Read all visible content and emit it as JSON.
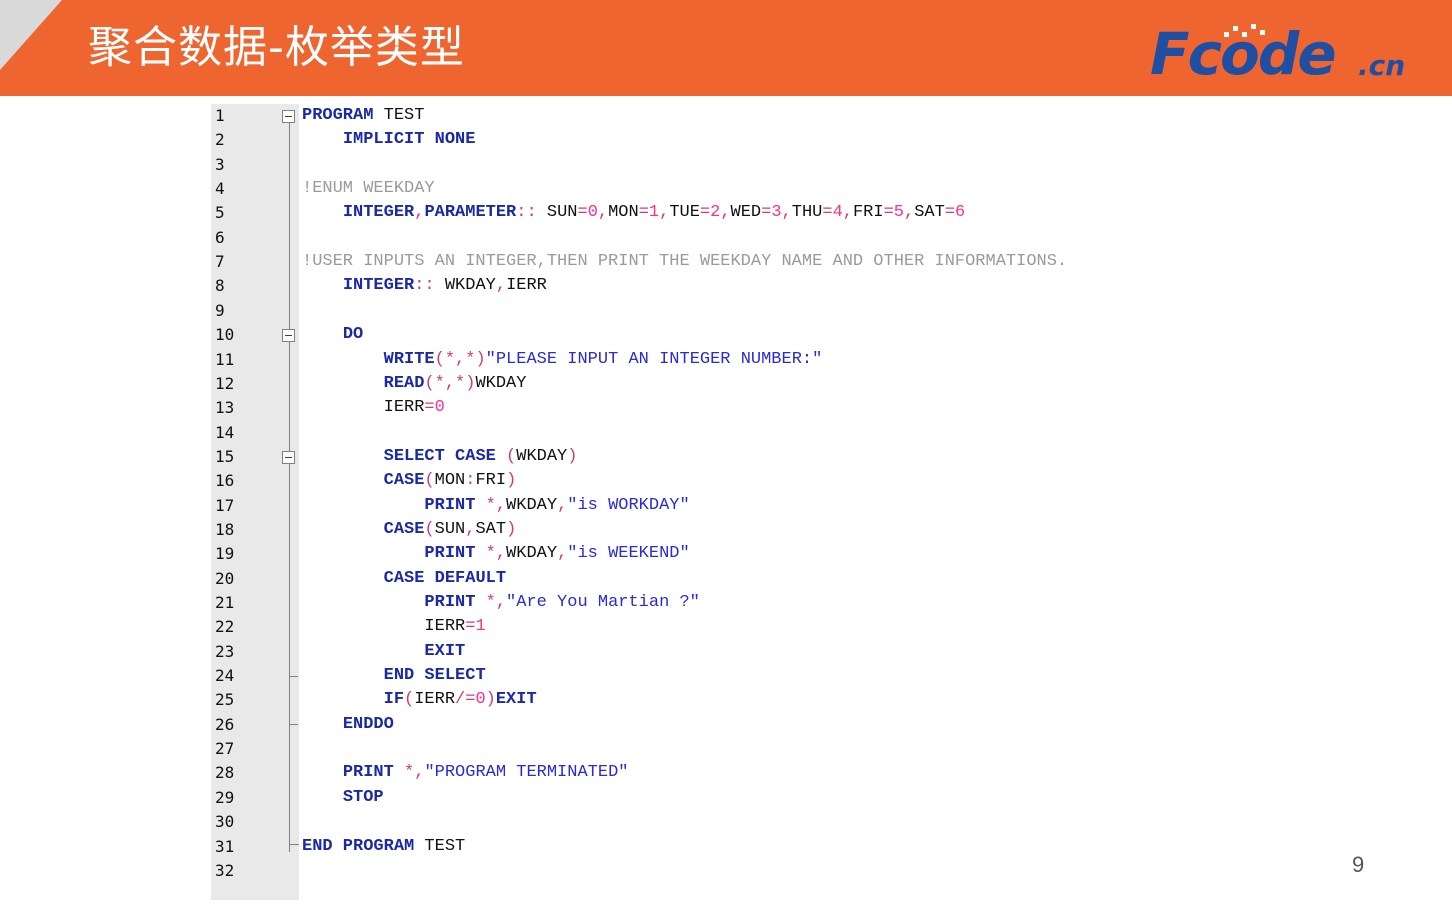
{
  "slide": {
    "title": "聚合数据-枚举类型",
    "page_number": "9",
    "logo": {
      "main": "Fcode",
      "suffix": ".cn"
    },
    "colors": {
      "header_bg": "#ef6530",
      "keyword": "#1a2aa6",
      "number": "#ff2f8f",
      "string": "#2a2ad8",
      "comment": "#9a9a9a"
    }
  },
  "code": {
    "lines": [
      {
        "n": "1",
        "tokens": [
          [
            "kw",
            "PROGRAM"
          ],
          [
            "id",
            " TEST"
          ]
        ]
      },
      {
        "n": "2",
        "tokens": [
          [
            "id",
            "    "
          ],
          [
            "kw",
            "IMPLICIT NONE"
          ]
        ]
      },
      {
        "n": "3",
        "tokens": []
      },
      {
        "n": "4",
        "tokens": [
          [
            "cm",
            "!ENUM WEEKDAY"
          ]
        ]
      },
      {
        "n": "5",
        "tokens": [
          [
            "id",
            "    "
          ],
          [
            "kw",
            "INTEGER"
          ],
          [
            "op",
            ","
          ],
          [
            "kw",
            "PARAMETER"
          ],
          [
            "op",
            "::"
          ],
          [
            "id",
            " SUN"
          ],
          [
            "op",
            "="
          ],
          [
            "num",
            "0"
          ],
          [
            "op",
            ","
          ],
          [
            "id",
            "MON"
          ],
          [
            "op",
            "="
          ],
          [
            "num",
            "1"
          ],
          [
            "op",
            ","
          ],
          [
            "id",
            "TUE"
          ],
          [
            "op",
            "="
          ],
          [
            "num",
            "2"
          ],
          [
            "op",
            ","
          ],
          [
            "id",
            "WED"
          ],
          [
            "op",
            "="
          ],
          [
            "num",
            "3"
          ],
          [
            "op",
            ","
          ],
          [
            "id",
            "THU"
          ],
          [
            "op",
            "="
          ],
          [
            "num",
            "4"
          ],
          [
            "op",
            ","
          ],
          [
            "id",
            "FRI"
          ],
          [
            "op",
            "="
          ],
          [
            "num",
            "5"
          ],
          [
            "op",
            ","
          ],
          [
            "id",
            "SAT"
          ],
          [
            "op",
            "="
          ],
          [
            "num",
            "6"
          ]
        ]
      },
      {
        "n": "6",
        "tokens": []
      },
      {
        "n": "7",
        "tokens": [
          [
            "cm",
            "!USER INPUTS AN INTEGER,THEN PRINT THE WEEKDAY NAME AND OTHER INFORMATIONS."
          ]
        ]
      },
      {
        "n": "8",
        "tokens": [
          [
            "id",
            "    "
          ],
          [
            "kw",
            "INTEGER"
          ],
          [
            "op",
            "::"
          ],
          [
            "id",
            " WKDAY"
          ],
          [
            "op",
            ","
          ],
          [
            "id",
            "IERR"
          ]
        ]
      },
      {
        "n": "9",
        "tokens": []
      },
      {
        "n": "10",
        "tokens": [
          [
            "id",
            "    "
          ],
          [
            "kw",
            "DO"
          ]
        ]
      },
      {
        "n": "11",
        "tokens": [
          [
            "id",
            "        "
          ],
          [
            "kw",
            "WRITE"
          ],
          [
            "op",
            "(*,*)"
          ],
          [
            "str",
            "\"PLEASE INPUT AN INTEGER NUMBER:\""
          ]
        ]
      },
      {
        "n": "12",
        "tokens": [
          [
            "id",
            "        "
          ],
          [
            "kw",
            "READ"
          ],
          [
            "op",
            "(*,*)"
          ],
          [
            "id",
            "WKDAY"
          ]
        ]
      },
      {
        "n": "13",
        "tokens": [
          [
            "id",
            "        IERR"
          ],
          [
            "op",
            "="
          ],
          [
            "num",
            "0"
          ]
        ]
      },
      {
        "n": "14",
        "tokens": []
      },
      {
        "n": "15",
        "tokens": [
          [
            "id",
            "        "
          ],
          [
            "kw",
            "SELECT CASE"
          ],
          [
            "id",
            " "
          ],
          [
            "op",
            "("
          ],
          [
            "id",
            "WKDAY"
          ],
          [
            "op",
            ")"
          ]
        ]
      },
      {
        "n": "16",
        "tokens": [
          [
            "id",
            "        "
          ],
          [
            "kw",
            "CASE"
          ],
          [
            "op",
            "("
          ],
          [
            "id",
            "MON"
          ],
          [
            "op",
            ":"
          ],
          [
            "id",
            "FRI"
          ],
          [
            "op",
            ")"
          ]
        ]
      },
      {
        "n": "17",
        "tokens": [
          [
            "id",
            "            "
          ],
          [
            "kw",
            "PRINT"
          ],
          [
            "id",
            " "
          ],
          [
            "op",
            "*"
          ],
          [
            "op",
            ","
          ],
          [
            "id",
            "WKDAY"
          ],
          [
            "op",
            ","
          ],
          [
            "str",
            "\"is WORKDAY\""
          ]
        ]
      },
      {
        "n": "18",
        "tokens": [
          [
            "id",
            "        "
          ],
          [
            "kw",
            "CASE"
          ],
          [
            "op",
            "("
          ],
          [
            "id",
            "SUN"
          ],
          [
            "op",
            ","
          ],
          [
            "id",
            "SAT"
          ],
          [
            "op",
            ")"
          ]
        ]
      },
      {
        "n": "19",
        "tokens": [
          [
            "id",
            "            "
          ],
          [
            "kw",
            "PRINT"
          ],
          [
            "id",
            " "
          ],
          [
            "op",
            "*"
          ],
          [
            "op",
            ","
          ],
          [
            "id",
            "WKDAY"
          ],
          [
            "op",
            ","
          ],
          [
            "str",
            "\"is WEEKEND\""
          ]
        ]
      },
      {
        "n": "20",
        "tokens": [
          [
            "id",
            "        "
          ],
          [
            "kw",
            "CASE DEFAULT"
          ]
        ]
      },
      {
        "n": "21",
        "tokens": [
          [
            "id",
            "            "
          ],
          [
            "kw",
            "PRINT"
          ],
          [
            "id",
            " "
          ],
          [
            "op",
            "*"
          ],
          [
            "op",
            ","
          ],
          [
            "str",
            "\"Are You Martian ?\""
          ]
        ]
      },
      {
        "n": "22",
        "tokens": [
          [
            "id",
            "            IERR"
          ],
          [
            "op",
            "="
          ],
          [
            "num",
            "1"
          ]
        ]
      },
      {
        "n": "23",
        "tokens": [
          [
            "id",
            "            "
          ],
          [
            "kw",
            "EXIT"
          ]
        ]
      },
      {
        "n": "24",
        "tokens": [
          [
            "id",
            "        "
          ],
          [
            "kw",
            "END SELECT"
          ]
        ]
      },
      {
        "n": "25",
        "tokens": [
          [
            "id",
            "        "
          ],
          [
            "kw",
            "IF"
          ],
          [
            "op",
            "("
          ],
          [
            "id",
            "IERR"
          ],
          [
            "op",
            "/="
          ],
          [
            "num",
            "0"
          ],
          [
            "op",
            ")"
          ],
          [
            "kw",
            "EXIT"
          ]
        ]
      },
      {
        "n": "26",
        "tokens": [
          [
            "id",
            "    "
          ],
          [
            "kw",
            "ENDDO"
          ]
        ]
      },
      {
        "n": "27",
        "tokens": []
      },
      {
        "n": "28",
        "tokens": [
          [
            "id",
            "    "
          ],
          [
            "kw",
            "PRINT"
          ],
          [
            "id",
            " "
          ],
          [
            "op",
            "*"
          ],
          [
            "op",
            ","
          ],
          [
            "str",
            "\"PROGRAM TERMINATED\""
          ]
        ]
      },
      {
        "n": "29",
        "tokens": [
          [
            "id",
            "    "
          ],
          [
            "kw",
            "STOP"
          ]
        ]
      },
      {
        "n": "30",
        "tokens": []
      },
      {
        "n": "31",
        "tokens": [
          [
            "kw",
            "END PROGRAM"
          ],
          [
            "id",
            " TEST"
          ]
        ]
      },
      {
        "n": "32",
        "tokens": []
      }
    ]
  }
}
